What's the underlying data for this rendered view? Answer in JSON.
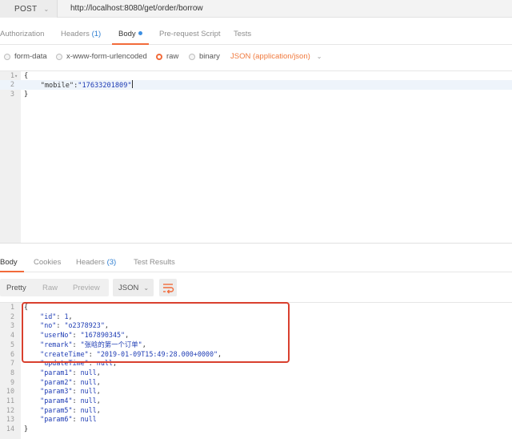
{
  "request": {
    "method": "POST",
    "url": "http://localhost:8080/get/order/borrow"
  },
  "request_tabs": [
    {
      "label": "Authorization",
      "count": ""
    },
    {
      "label": "Headers",
      "count": "(1)"
    },
    {
      "label": "Body",
      "count": ""
    },
    {
      "label": "Pre-request Script",
      "count": ""
    },
    {
      "label": "Tests",
      "count": ""
    }
  ],
  "body_types": [
    "form-data",
    "x-www-form-urlencoded",
    "raw",
    "binary"
  ],
  "body_type_selected": "raw",
  "content_type": "JSON (application/json)",
  "request_body": {
    "line_numbers": [
      "1",
      "2",
      "3"
    ],
    "line1": "{",
    "line2_key": "\"mobile\"",
    "line2_colon": ":",
    "line2_value": "\"17633201809\"",
    "line3": "}"
  },
  "response_tabs": [
    {
      "label": "Body",
      "count": ""
    },
    {
      "label": "Cookies",
      "count": ""
    },
    {
      "label": "Headers",
      "count": "(3)"
    },
    {
      "label": "Test Results",
      "count": ""
    }
  ],
  "view_modes": [
    "Pretty",
    "Raw",
    "Preview"
  ],
  "view_mode_selected": "Pretty",
  "format": "JSON",
  "response_lines": [
    {
      "n": "1",
      "indent": "",
      "key": "",
      "value": "{",
      "trail": ""
    },
    {
      "n": "2",
      "indent": "    ",
      "key": "\"id\"",
      "value": "1",
      "trail": ","
    },
    {
      "n": "3",
      "indent": "    ",
      "key": "\"no\"",
      "value": "\"o2378923\"",
      "trail": ","
    },
    {
      "n": "4",
      "indent": "    ",
      "key": "\"userNo\"",
      "value": "\"167890345\"",
      "trail": ","
    },
    {
      "n": "5",
      "indent": "    ",
      "key": "\"remark\"",
      "value": "\"张晗的第一个订单\"",
      "trail": ","
    },
    {
      "n": "6",
      "indent": "    ",
      "key": "\"createTime\"",
      "value": "\"2019-01-09T15:49:28.000+0000\"",
      "trail": ","
    },
    {
      "n": "7",
      "indent": "    ",
      "key": "\"updateTime\"",
      "value": "null",
      "trail": ","
    },
    {
      "n": "8",
      "indent": "    ",
      "key": "\"param1\"",
      "value": "null",
      "trail": ","
    },
    {
      "n": "9",
      "indent": "    ",
      "key": "\"param2\"",
      "value": "null",
      "trail": ","
    },
    {
      "n": "10",
      "indent": "    ",
      "key": "\"param3\"",
      "value": "null",
      "trail": ","
    },
    {
      "n": "11",
      "indent": "    ",
      "key": "\"param4\"",
      "value": "null",
      "trail": ","
    },
    {
      "n": "12",
      "indent": "    ",
      "key": "\"param5\"",
      "value": "null",
      "trail": ","
    },
    {
      "n": "13",
      "indent": "    ",
      "key": "\"param6\"",
      "value": "null",
      "trail": ""
    },
    {
      "n": "14",
      "indent": "",
      "key": "",
      "value": "}",
      "trail": ""
    }
  ],
  "colors": {
    "accent": "#f26b3a",
    "annotation_box": "#d9402e",
    "json_string": "#1e3cb4",
    "count_badge": "#2f7fd2"
  }
}
